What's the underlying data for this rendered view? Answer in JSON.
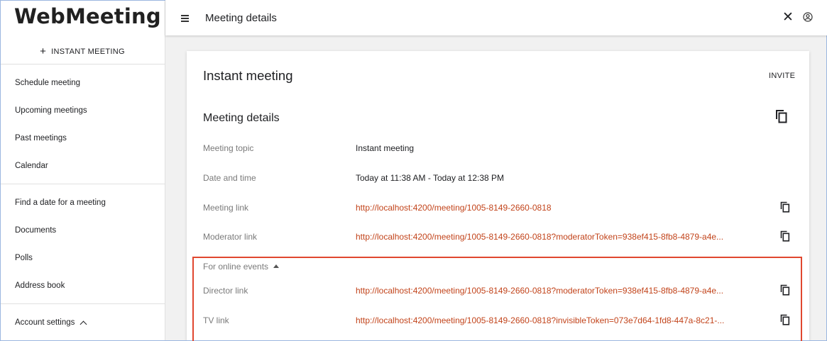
{
  "app": {
    "logo": "WebMeeting",
    "instant_meeting_label": "INSTANT MEETING"
  },
  "sidebar": {
    "items": [
      {
        "label": "Schedule meeting"
      },
      {
        "label": "Upcoming meetings"
      },
      {
        "label": "Past meetings"
      },
      {
        "label": "Calendar"
      },
      {
        "label": "Find a date for a meeting"
      },
      {
        "label": "Documents"
      },
      {
        "label": "Polls"
      },
      {
        "label": "Address book"
      },
      {
        "label": "Account settings"
      }
    ]
  },
  "topbar": {
    "title": "Meeting details",
    "icons": [
      "menu-icon",
      "close-icon",
      "user-icon"
    ]
  },
  "card": {
    "title": "Instant meeting",
    "invite_label": "INVITE",
    "section_title": "Meeting details",
    "rows": [
      {
        "label": "Meeting topic",
        "value": "Instant meeting"
      },
      {
        "label": "Date and time",
        "value": "Today at 11:38 AM - Today at 12:38 PM"
      },
      {
        "label": "Meeting link",
        "value": "http://localhost:4200/meeting/1005-8149-2660-0818"
      },
      {
        "label": "Moderator link",
        "value": "http://localhost:4200/meeting/1005-8149-2660-0818?moderatorToken=938ef415-8fb8-4879-a4e..."
      }
    ],
    "online_events": {
      "toggle_label": "For online events",
      "rows": [
        {
          "label": "Director link",
          "value": "http://localhost:4200/meeting/1005-8149-2660-0818?moderatorToken=938ef415-8fb8-4879-a4e..."
        },
        {
          "label": "TV link",
          "value": "http://localhost:4200/meeting/1005-8149-2660-0818?invisibleToken=073e7d64-1fd8-447a-8c21-..."
        }
      ]
    }
  },
  "colors": {
    "link": "#c2441b",
    "highlight": "#e0472f",
    "background": "#f1f1f1"
  }
}
